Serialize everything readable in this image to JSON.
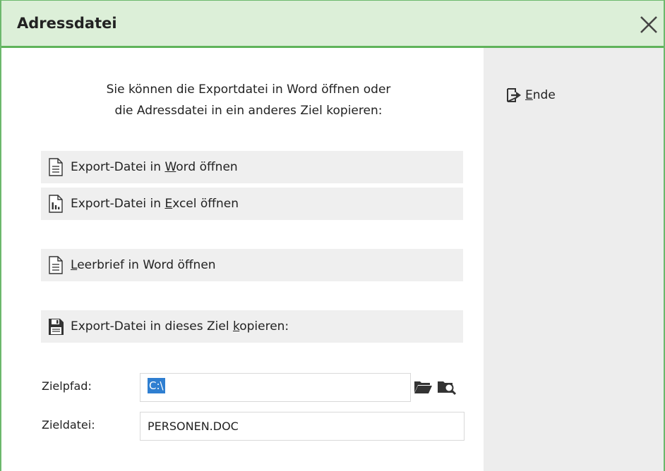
{
  "window": {
    "title": "Adressdatei"
  },
  "intro": {
    "line1": "Sie können die Exportdatei in Word öffnen oder",
    "line2": "die Adressdatei in ein anderes Ziel kopieren:"
  },
  "actions": {
    "word_export": {
      "pre": "Export-Datei in ",
      "key": "W",
      "post": "ord öffnen",
      "icon": "document-icon"
    },
    "excel_export": {
      "pre": "Export-Datei in ",
      "key": "E",
      "post": "xcel öffnen",
      "icon": "chart-document-icon"
    },
    "leerbrief": {
      "pre": "",
      "key": "L",
      "post": "eerbrief in Word öffnen",
      "icon": "document-icon"
    },
    "copy_target": {
      "pre": "Export-Datei in dieses Ziel ",
      "key": "k",
      "post": "opieren:",
      "icon": "save-icon"
    }
  },
  "fields": {
    "zielpfad": {
      "label": "Zielpfad:",
      "value": "C:\\"
    },
    "zieldatei": {
      "label": "Zieldatei:",
      "value": "PERSONEN.DOC"
    }
  },
  "side": {
    "ende": {
      "key": "E",
      "post": "nde",
      "icon": "exit-icon"
    }
  },
  "colors": {
    "titlebar_bg": "#dcefd8",
    "titlebar_accent": "#5fb35a",
    "selection": "#2f7fd1",
    "button_bg": "#efefef",
    "side_panel_bg": "#ededed"
  }
}
